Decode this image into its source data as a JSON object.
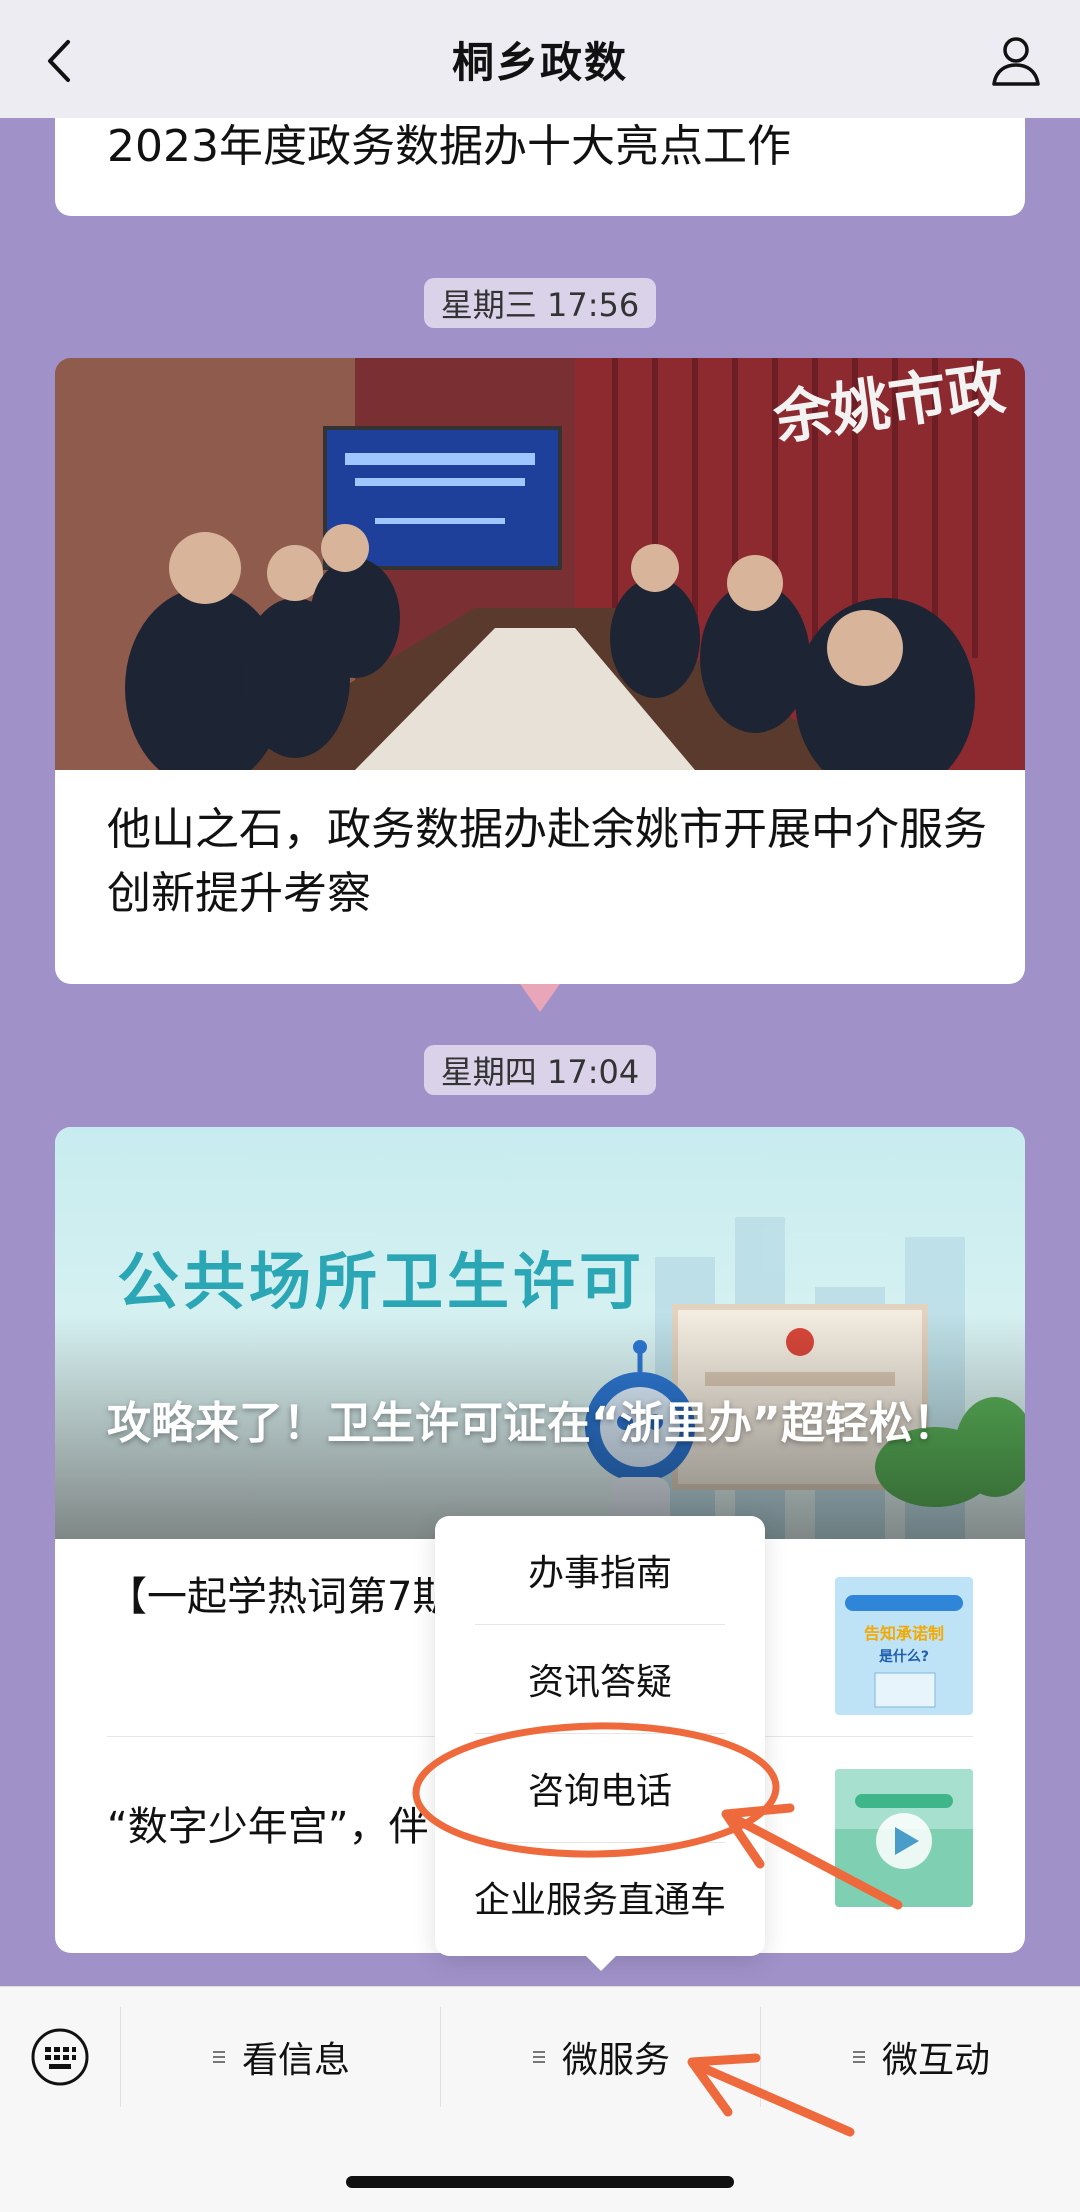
{
  "header": {
    "title": "桐乡政数"
  },
  "feed": {
    "card1_text": "2023年度政务数据办十大亮点工作",
    "stamp1": "星期三 17:56",
    "card2_headline": "他山之石，政务数据办赴余姚市开展中介服务创新提升考察",
    "stamp2": "星期四 17:04",
    "banner_title": "公共场所卫生许可",
    "banner_headline": "攻略来了！卫生许可证在“浙里办”超轻松！",
    "list_item1": "【一起学热词第7期什么?",
    "list_item2": "“数字少年宫”，伴"
  },
  "popup": {
    "items": [
      "办事指南",
      "资讯答疑",
      "咨询电话",
      "企业服务直通车"
    ]
  },
  "bottom_menu": {
    "items": [
      "看信息",
      "微服务",
      "微互动"
    ]
  },
  "colors": {
    "background": "#a092c9",
    "annotation": "#ee6a3d",
    "banner_teal": "#2aa6b5"
  }
}
